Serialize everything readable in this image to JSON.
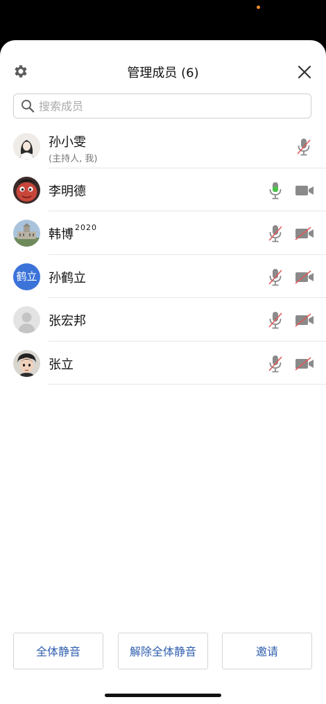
{
  "header": {
    "title": "管理成员 (6)",
    "settings_icon": "gear-icon",
    "close_icon": "close-icon"
  },
  "search": {
    "placeholder": "搜索成员",
    "value": ""
  },
  "members": [
    {
      "name": "孙小雯",
      "role": "(主持人, 我)",
      "mic": "muted",
      "camera": "none",
      "avatar": "photo-woman-illustration"
    },
    {
      "name": "李明德",
      "role": "",
      "mic": "active",
      "camera": "on",
      "avatar": "photo-cartoon-character"
    },
    {
      "name": "韩博",
      "superscript": "2020",
      "role": "",
      "mic": "muted",
      "camera": "off",
      "avatar": "photo-building"
    },
    {
      "name": "孙鹤立",
      "avatar_text": "鹤立",
      "role": "",
      "mic": "muted",
      "camera": "off",
      "avatar": "text"
    },
    {
      "name": "张宏邦",
      "role": "",
      "mic": "muted",
      "camera": "off",
      "avatar": "default-person"
    },
    {
      "name": "张立",
      "role": "",
      "mic": "muted",
      "camera": "off",
      "avatar": "photo-cartoon-girl"
    }
  ],
  "footer": {
    "mute_all": "全体静音",
    "unmute_all": "解除全体静音",
    "invite": "邀请"
  },
  "colors": {
    "accent_blue": "#2f5fae",
    "avatar_blue": "#3b73d9",
    "mic_active_green": "#4cc24a",
    "muted_red": "#e05a5a",
    "status_dot": "#f08a2c"
  }
}
